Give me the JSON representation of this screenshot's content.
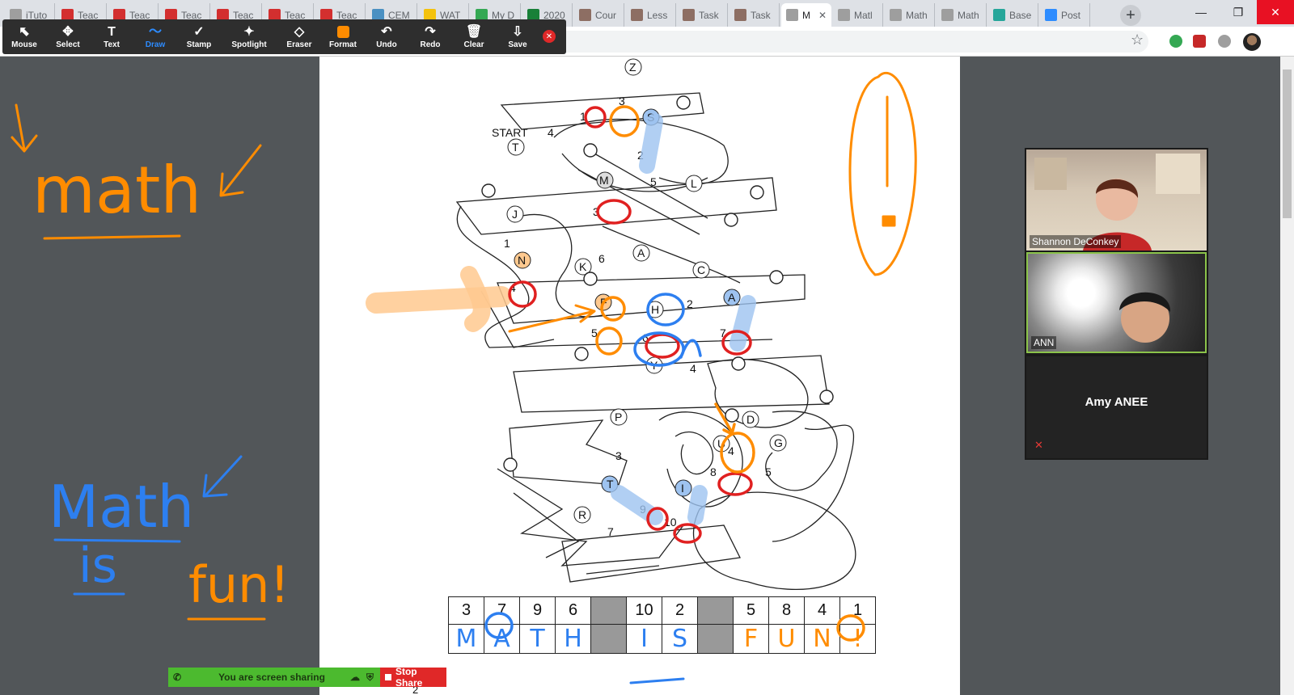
{
  "browser": {
    "tabs": [
      {
        "title": "iTuto",
        "icon": "globe-icon",
        "color": "#9e9e9e"
      },
      {
        "title": "Teac",
        "icon": "i-icon",
        "color": "#d32f2f"
      },
      {
        "title": "Teac",
        "icon": "i-icon",
        "color": "#d32f2f"
      },
      {
        "title": "Teac",
        "icon": "i-icon",
        "color": "#d32f2f"
      },
      {
        "title": "Teac",
        "icon": "i-icon",
        "color": "#d32f2f"
      },
      {
        "title": "Teac",
        "icon": "i-icon",
        "color": "#d32f2f"
      },
      {
        "title": "Teac",
        "icon": "i-icon",
        "color": "#d32f2f"
      },
      {
        "title": "CEM",
        "icon": "diamond-icon",
        "color": "#4a90c2"
      },
      {
        "title": "WAT",
        "icon": "circle-icon",
        "color": "#f4c20d"
      },
      {
        "title": "My D",
        "icon": "drive-icon",
        "color": "#34a853"
      },
      {
        "title": "2020",
        "icon": "sheets-icon",
        "color": "#188038"
      },
      {
        "title": "Cour",
        "icon": "doc-icon",
        "color": "#8d6e63"
      },
      {
        "title": "Less",
        "icon": "doc-icon",
        "color": "#8d6e63"
      },
      {
        "title": "Task",
        "icon": "doc-icon",
        "color": "#8d6e63"
      },
      {
        "title": "Task",
        "icon": "doc-icon",
        "color": "#8d6e63"
      },
      {
        "title": "M",
        "icon": "globe-icon",
        "color": "#9e9e9e",
        "active": true
      },
      {
        "title": "Matl",
        "icon": "globe-icon",
        "color": "#9e9e9e"
      },
      {
        "title": "Math",
        "icon": "globe-icon",
        "color": "#9e9e9e"
      },
      {
        "title": "Math",
        "icon": "globe-icon",
        "color": "#9e9e9e"
      },
      {
        "title": "Base",
        "icon": "smile-icon",
        "color": "#26a69a"
      },
      {
        "title": "Post",
        "icon": "video-icon",
        "color": "#2d8cff"
      }
    ],
    "new_tab": "+",
    "minimize": "—",
    "maximize": "❐",
    "close": "✕",
    "star": "☆"
  },
  "toolbar": {
    "tools": [
      {
        "label": "Mouse",
        "icon": "⬉"
      },
      {
        "label": "Select",
        "icon": "✥"
      },
      {
        "label": "Text",
        "icon": "T"
      },
      {
        "label": "Draw",
        "icon": "〜",
        "selected": true
      },
      {
        "label": "Stamp",
        "icon": "✓"
      },
      {
        "label": "Spotlight",
        "icon": "✦",
        "wide": true
      },
      {
        "label": "Eraser",
        "icon": "◇"
      },
      {
        "label": "Format",
        "icon": ""
      },
      {
        "label": "Undo",
        "icon": "↶"
      },
      {
        "label": "Redo",
        "icon": "↷"
      },
      {
        "label": "Clear",
        "icon": "🗑"
      },
      {
        "label": "Save",
        "icon": "⇩"
      }
    ],
    "format_color": "#ff8c00",
    "close_icon": "✕"
  },
  "worksheet": {
    "start_label": "START",
    "balloons": [
      "Z",
      "T",
      "S",
      "M",
      "L",
      "J",
      "N",
      "K",
      "A",
      "C",
      "F",
      "H",
      "A",
      "Y",
      "P",
      "D",
      "U",
      "G",
      "T",
      "I",
      "R"
    ],
    "numbers": [
      "3",
      "4",
      "1",
      "2",
      "5",
      "3",
      "1",
      "4",
      "6",
      "5",
      "2",
      "6",
      "7",
      "4",
      "3",
      "8",
      "5",
      "9",
      "10",
      "7",
      "4"
    ],
    "answer_table": {
      "numbers": [
        "3",
        "7",
        "9",
        "6",
        "",
        "10",
        "2",
        "",
        "5",
        "8",
        "4",
        "1"
      ],
      "letters": [
        "M",
        "A",
        "T",
        "H",
        "",
        "I",
        "S",
        "",
        "F",
        "U",
        "N",
        "!"
      ]
    },
    "page_number": "2"
  },
  "whiteboard": {
    "word1": "math",
    "word2": "Math",
    "word3": "is",
    "word4": "fun!"
  },
  "video": {
    "participants": [
      {
        "name": "Shannon DeConkey"
      },
      {
        "name": "ANN"
      },
      {
        "name": "Amy ANEE"
      }
    ]
  },
  "share_bar": {
    "status": "You are screen sharing",
    "stop_label": "Stop Share"
  },
  "colors": {
    "orange_ink": "#ff8c00",
    "blue_ink": "#2d7ff0",
    "red_ink": "#e02020",
    "zoom_green": "#4cba2f",
    "zoom_red": "#e02828"
  }
}
